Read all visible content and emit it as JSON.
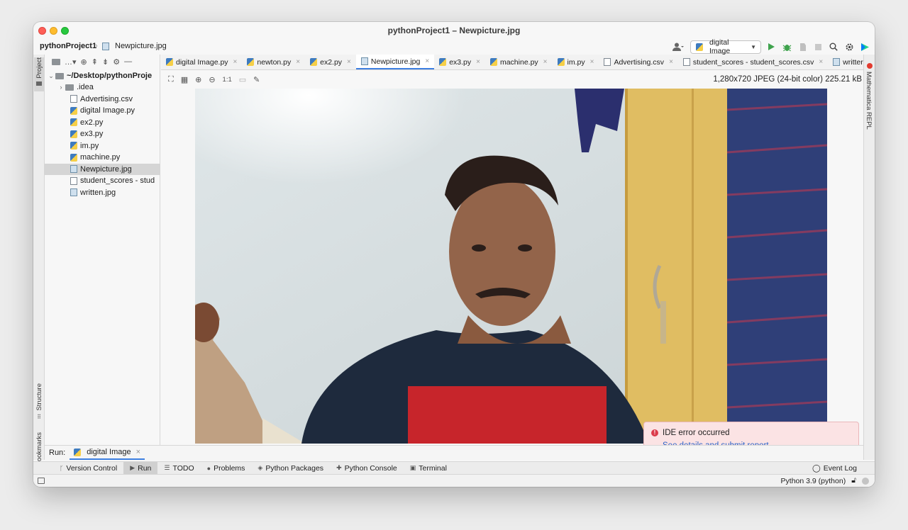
{
  "window": {
    "title": "pythonProject1 – Newpicture.jpg"
  },
  "breadcrumb": {
    "project": "pythonProject1",
    "file": "Newpicture.jpg"
  },
  "toolbar": {
    "run_config": "digital Image"
  },
  "stripes": {
    "project": "Project",
    "structure": "Structure",
    "bookmarks": "Bookmarks",
    "right": "Mathematica REPL"
  },
  "project_tree": {
    "root": "~/Desktop/pythonProje",
    "items": [
      {
        "label": ".idea",
        "type": "folder"
      },
      {
        "label": "Advertising.csv",
        "type": "csv"
      },
      {
        "label": "digital Image.py",
        "type": "py"
      },
      {
        "label": "ex2.py",
        "type": "py"
      },
      {
        "label": "ex3.py",
        "type": "py"
      },
      {
        "label": "im.py",
        "type": "py"
      },
      {
        "label": "machine.py",
        "type": "py"
      },
      {
        "label": "Newpicture.jpg",
        "type": "img",
        "selected": true
      },
      {
        "label": "student_scores - stud",
        "type": "csv"
      },
      {
        "label": "written.jpg",
        "type": "img"
      }
    ]
  },
  "tabs": [
    {
      "label": "digital Image.py",
      "type": "py"
    },
    {
      "label": "newton.py",
      "type": "py"
    },
    {
      "label": "ex2.py",
      "type": "py"
    },
    {
      "label": "Newpicture.jpg",
      "type": "img",
      "active": true
    },
    {
      "label": "ex3.py",
      "type": "py"
    },
    {
      "label": "machine.py",
      "type": "py"
    },
    {
      "label": "im.py",
      "type": "py"
    },
    {
      "label": "Advertising.csv",
      "type": "csv"
    },
    {
      "label": "student_scores - student_scores.csv",
      "type": "csv"
    },
    {
      "label": "writter",
      "type": "img"
    }
  ],
  "image_viewer": {
    "zoom_actual": "1:1",
    "info": "1,280x720 JPEG (24-bit color) 225.21 kB"
  },
  "notification": {
    "title": "IDE error occurred",
    "link": "See details and submit report"
  },
  "run_panel": {
    "label": "Run:",
    "tab": "digital Image"
  },
  "tool_windows": [
    {
      "label": "Version Control",
      "icon": "branch-icon"
    },
    {
      "label": "Run",
      "icon": "play-icon",
      "active": true
    },
    {
      "label": "TODO",
      "icon": "list-icon"
    },
    {
      "label": "Problems",
      "icon": "warning-icon"
    },
    {
      "label": "Python Packages",
      "icon": "layers-icon"
    },
    {
      "label": "Python Console",
      "icon": "python-icon"
    },
    {
      "label": "Terminal",
      "icon": "terminal-icon"
    }
  ],
  "event_log": "Event Log",
  "status": {
    "interpreter": "Python 3.9 (python)"
  }
}
